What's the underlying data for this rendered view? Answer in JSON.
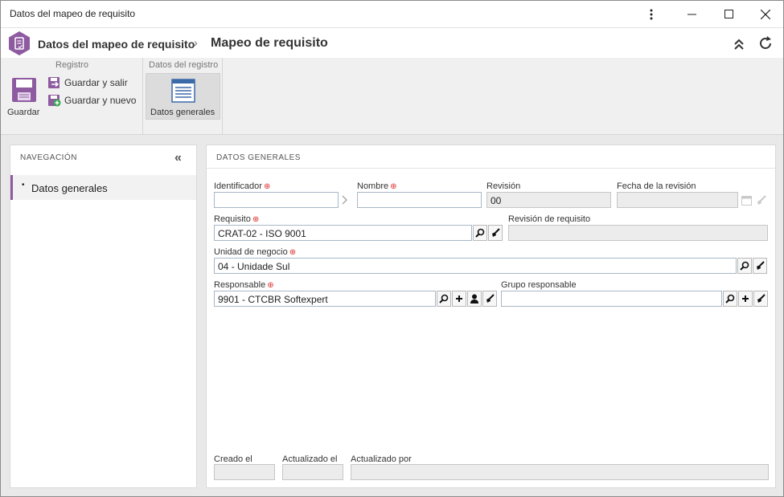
{
  "window": {
    "title": "Datos del mapeo de requisito"
  },
  "header": {
    "breadcrumb_parent": "Datos del mapeo de requisito",
    "separator": "›",
    "breadcrumb_current": "Mapeo de requisito"
  },
  "ribbon": {
    "group_registro": "Registro",
    "group_datos": "Datos del registro",
    "save_label": "Guardar",
    "save_exit_label": "Guardar y salir",
    "save_new_label": "Guardar y nuevo",
    "general_label": "Datos generales"
  },
  "navigation": {
    "title": "NAVEGACIÓN",
    "items": [
      {
        "label": "Datos generales"
      }
    ]
  },
  "form": {
    "title": "DATOS GENERALES",
    "identificador": {
      "label": "Identificador",
      "value": ""
    },
    "nombre": {
      "label": "Nombre",
      "value": ""
    },
    "revision": {
      "label": "Revisión",
      "value": "00"
    },
    "fecha_revision": {
      "label": "Fecha de la revisión",
      "value": ""
    },
    "requisito": {
      "label": "Requisito",
      "value": "CRAT-02 - ISO 9001"
    },
    "revision_requisito": {
      "label": "Revisión de requisito",
      "value": ""
    },
    "unidad_negocio": {
      "label": "Unidad de negocio",
      "value": "04 - Unidade Sul"
    },
    "responsable": {
      "label": "Responsable",
      "value": "9901 - CTCBR Softexpert"
    },
    "grupo_responsable": {
      "label": "Grupo responsable",
      "value": ""
    },
    "creado_el": {
      "label": "Creado el",
      "value": ""
    },
    "actualizado_el": {
      "label": "Actualizado el",
      "value": ""
    },
    "actualizado_por": {
      "label": "Actualizado por",
      "value": ""
    }
  },
  "colors": {
    "accent": "#8e5aa0",
    "required": "#d9302a",
    "field_border": "#a9b7c6"
  }
}
